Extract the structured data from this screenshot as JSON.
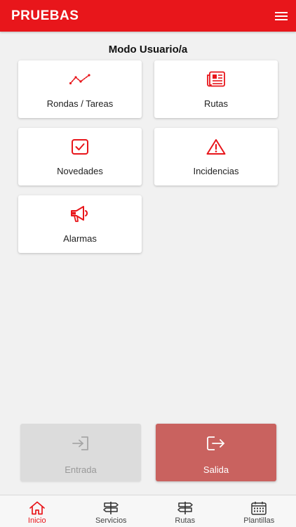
{
  "header": {
    "title": "PRUEBAS"
  },
  "main": {
    "title": "Modo Usuario/a",
    "tiles": [
      {
        "label": "Rondas / Tareas",
        "icon": "trend-line-icon"
      },
      {
        "label": "Rutas",
        "icon": "newspaper-icon"
      },
      {
        "label": "Novedades",
        "icon": "checkbox-icon"
      },
      {
        "label": "Incidencias",
        "icon": "warning-triangle-icon"
      },
      {
        "label": "Alarmas",
        "icon": "megaphone-icon"
      }
    ]
  },
  "actions": {
    "entrada": {
      "label": "Entrada",
      "icon": "sign-in-icon"
    },
    "salida": {
      "label": "Salida",
      "icon": "sign-out-icon"
    }
  },
  "tabbar": {
    "items": [
      {
        "label": "Inicio",
        "icon": "home-icon"
      },
      {
        "label": "Servicios",
        "icon": "signpost-icon"
      },
      {
        "label": "Rutas",
        "icon": "signpost-icon"
      },
      {
        "label": "Plantillas",
        "icon": "calendar-icon"
      }
    ]
  },
  "colors": {
    "brand": "#e8161b",
    "salida_bg": "#c9625f",
    "entrada_bg": "#dcdcdc",
    "background": "#f1f1f1"
  }
}
